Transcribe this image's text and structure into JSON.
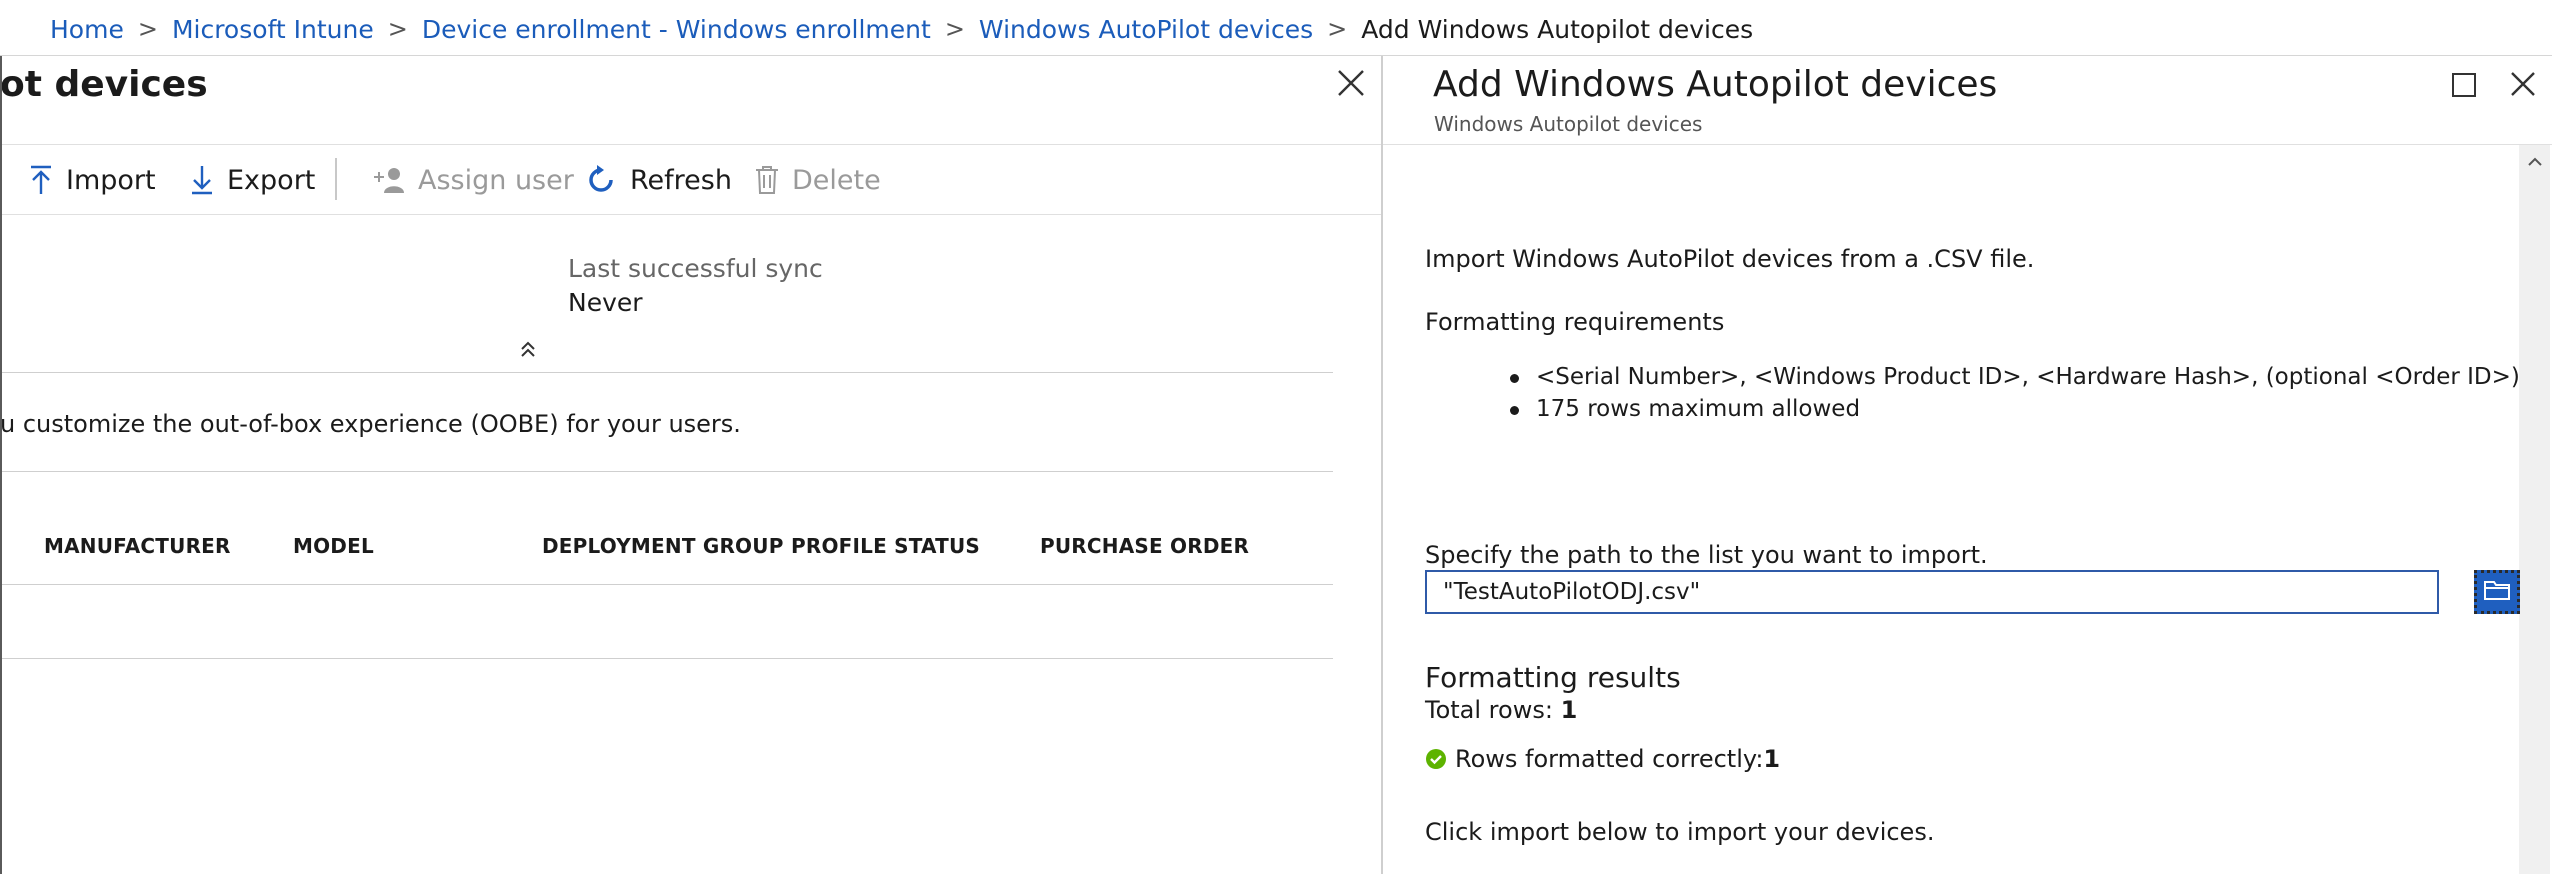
{
  "breadcrumb": {
    "items": [
      "Home",
      "Microsoft Intune",
      "Device enrollment - Windows enrollment",
      "Windows AutoPilot devices"
    ],
    "current": "Add Windows Autopilot devices"
  },
  "left_blade": {
    "title": "ot devices",
    "toolbar": {
      "import": "Import",
      "export": "Export",
      "assign_user": "Assign user",
      "refresh": "Refresh",
      "delete": "Delete"
    },
    "sync": {
      "label": "Last successful sync",
      "value": "Never"
    },
    "info_text": "u customize the out-of-box experience (OOBE) for your users.",
    "columns": [
      "MANUFACTURER",
      "MODEL",
      "DEPLOYMENT GROUP",
      "PROFILE STATUS",
      "PURCHASE ORDER"
    ]
  },
  "right_blade": {
    "title": "Add Windows Autopilot devices",
    "subtitle": "Windows Autopilot devices",
    "intro": "Import Windows AutoPilot devices from a .CSV file.",
    "requirements_heading": "Formatting requirements",
    "requirements": [
      "<Serial Number>, <Windows Product ID>, <Hardware Hash>, (optional <Order ID>)",
      "175 rows maximum allowed"
    ],
    "path_label": "Specify the path to the list you want to import.",
    "path_value": "\"TestAutoPilotODJ.csv\"",
    "results_heading": "Formatting results",
    "total_rows_label": "Total rows: ",
    "total_rows_value": "1",
    "rows_ok_label": "Rows formatted correctly: ",
    "rows_ok_value": "1",
    "footer_text": "Click import below to import your devices."
  },
  "colors": {
    "link": "#1b5cba",
    "accent": "#1f5fbf",
    "success": "#5db300",
    "disabled": "#9a9a9a"
  },
  "icons": {
    "import": "import-arrow-up-icon",
    "export": "export-arrow-down-icon",
    "assign_user": "assign-user-icon",
    "refresh": "refresh-icon",
    "delete": "trash-icon",
    "close": "close-icon",
    "maximize": "maximize-icon",
    "browse": "folder-icon",
    "success": "check-circle-icon"
  }
}
